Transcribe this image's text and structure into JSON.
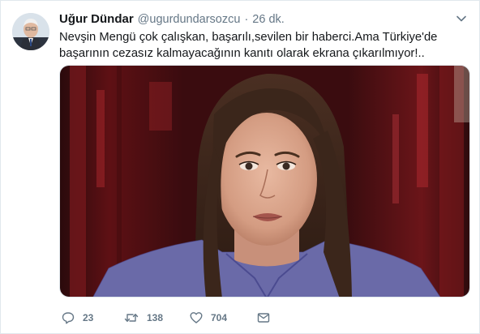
{
  "tweet": {
    "author_name": "Uğur Dündar",
    "handle": "@ugurdundarsozcu",
    "separator": "·",
    "time": "26 dk.",
    "text_line_1": "Nevşin Mengü çok çalışkan, başarılı,sevilen bir haberci.Ama Türkiye'de",
    "text_line_2": "başarının cezasız kalmayacağının kanıtı olarak ekrana çıkarılmıyor!..",
    "media_description": "photo-news-anchor",
    "actions": {
      "reply_count": "23",
      "retweet_count": "138",
      "like_count": "704"
    }
  },
  "icons": {
    "avatar": "avatar-portrait",
    "caret": "chevron-down-icon",
    "reply": "reply-icon",
    "retweet": "retweet-icon",
    "like": "heart-icon",
    "dm": "envelope-icon"
  },
  "colors": {
    "text": "#14171a",
    "secondary": "#657786",
    "border": "#e1e8ed"
  }
}
